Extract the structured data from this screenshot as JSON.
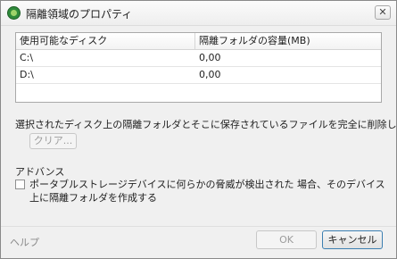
{
  "window": {
    "title": "隔離領域のプロパティ",
    "close_glyph": "✕"
  },
  "disk_table": {
    "columns": [
      "使用可能なディスク",
      "隔離フォルダの容量(MB)"
    ],
    "rows": [
      [
        "C:\\",
        "0,00"
      ],
      [
        "D:\\",
        "0,00"
      ]
    ]
  },
  "quarantine": {
    "delete_description": "選択されたディスク上の隔離フォルダとそこに保存されているファイルを完全に削除します",
    "clear_button": "クリア..."
  },
  "advanced": {
    "section_label": "アドバンス",
    "portable_checkbox_label": "ポータブルストレージデバイスに何らかの脅威が検出された 場合、そのデバイス上に隔離フォルダを作成する",
    "portable_checkbox_checked": false
  },
  "footer": {
    "help_link": "ヘルプ",
    "ok_button": "OK",
    "cancel_button": "キャンセル"
  }
}
